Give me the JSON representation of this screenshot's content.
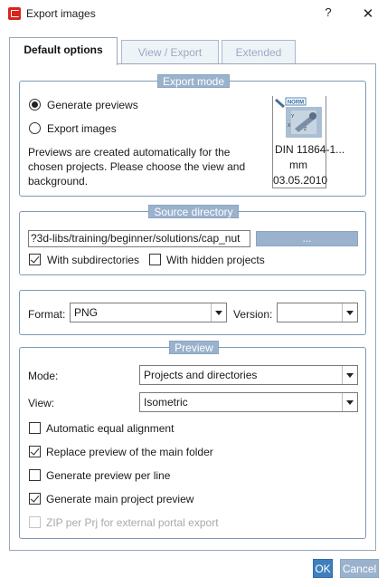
{
  "window": {
    "title": "Export images",
    "help_label": "?",
    "close_label": "✕"
  },
  "tabs": [
    {
      "label": "Default options",
      "active": true
    },
    {
      "label": "View / Export",
      "active": false
    },
    {
      "label": "Extended",
      "active": false
    }
  ],
  "export_mode": {
    "legend": "Export mode",
    "options": [
      {
        "label": "Generate previews",
        "selected": true
      },
      {
        "label": "Export images",
        "selected": false
      }
    ],
    "description_lines": [
      "Previews are created automatically for the",
      "chosen projects. Please choose the view and",
      "background."
    ],
    "preview": {
      "logo_text": "NORM",
      "caption_lines": [
        "DIN 11864-1...",
        "mm",
        "03.05.2010"
      ]
    }
  },
  "source_directory": {
    "legend": "Source directory",
    "path_value": "?3d-libs/training/beginner/solutions/cap_nut",
    "browse_label": "...",
    "with_subdirectories": {
      "label": "With subdirectories",
      "checked": true
    },
    "with_hidden_projects": {
      "label": "With hidden projects",
      "checked": false
    }
  },
  "format_row": {
    "format_label": "Format:",
    "format_value": "PNG",
    "version_label": "Version:",
    "version_value": ""
  },
  "preview_group": {
    "legend": "Preview",
    "mode_label": "Mode:",
    "mode_value": "Projects and directories",
    "view_label": "View:",
    "view_value": "Isometric",
    "checkboxes": [
      {
        "label": "Automatic equal alignment",
        "checked": false,
        "disabled": false
      },
      {
        "label": "Replace preview of the main folder",
        "checked": true,
        "disabled": false
      },
      {
        "label": "Generate preview per line",
        "checked": false,
        "disabled": false
      },
      {
        "label": "Generate main project preview",
        "checked": true,
        "disabled": false
      },
      {
        "label": "ZIP per Prj for external portal export",
        "checked": false,
        "disabled": true
      }
    ]
  },
  "footer": {
    "ok_label": "OK",
    "cancel_label": "Cancel"
  },
  "colors": {
    "accent": "#3f7fbd",
    "legend_bg": "#9ab2cc",
    "group_border": "#7d99b5",
    "app_icon": "#d9241b"
  }
}
